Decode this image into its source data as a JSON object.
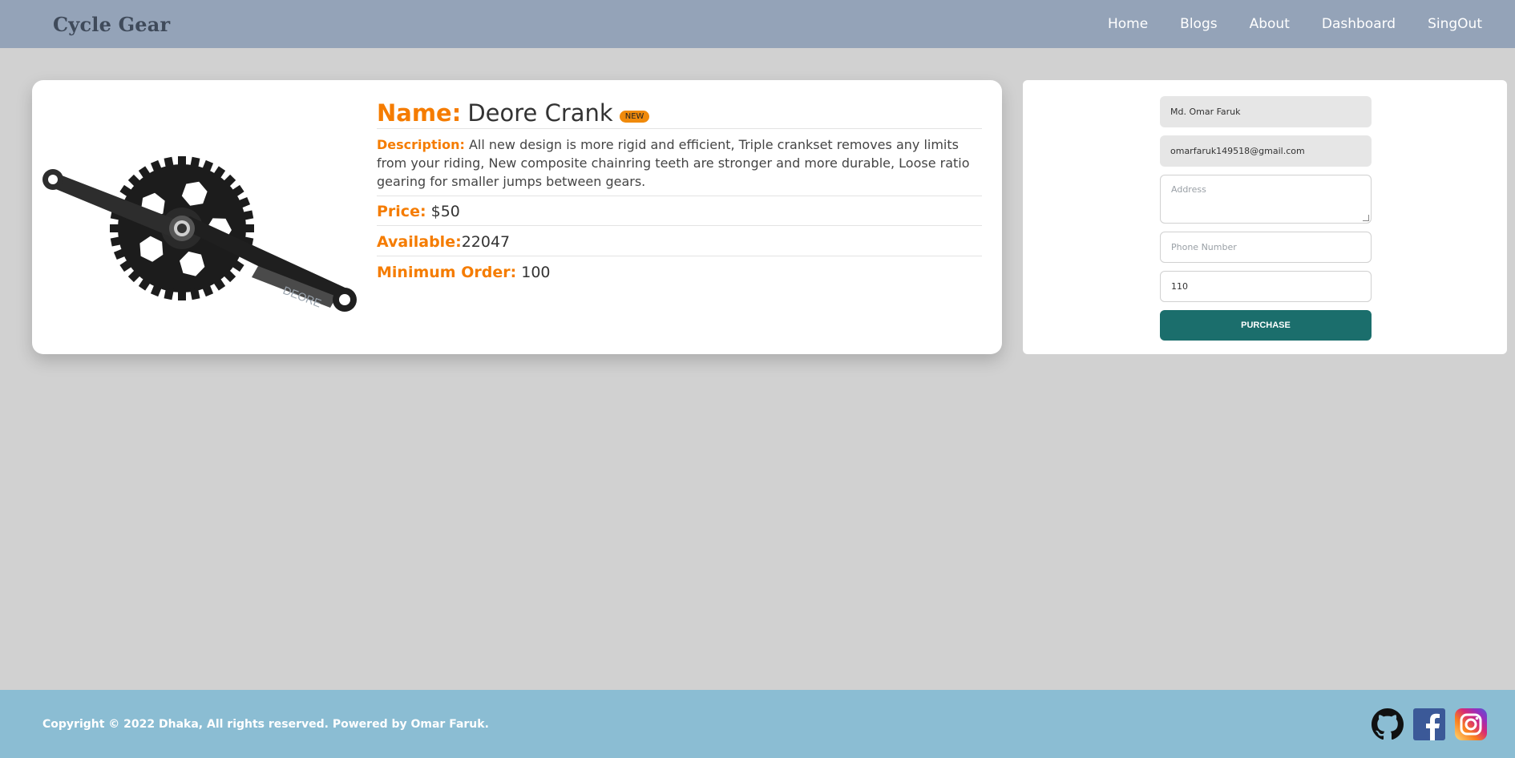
{
  "brand": "Cycle Gear",
  "nav": {
    "home": "Home",
    "blogs": "Blogs",
    "about": "About",
    "dashboard": "Dashboard",
    "signout": "SingOut"
  },
  "product": {
    "name_label": "Name:",
    "name": "Deore Crank",
    "badge": "NEW",
    "description_label": "Description:",
    "description": "All new design is more rigid and efficient, Triple crankset removes any limits from your riding, New composite chainring teeth are stronger and more durable, Loose ratio gearing for smaller jumps between gears.",
    "price_label": "Price:",
    "price": "$50",
    "available_label": "Available:",
    "available": "22047",
    "min_order_label": "Minimum Order:",
    "min_order": "100",
    "image_text": "DEORE"
  },
  "form": {
    "name_value": "Md. Omar Faruk",
    "email_value": "omarfaruk149518@gmail.com",
    "address_placeholder": "Address",
    "phone_placeholder": "Phone Number",
    "quantity_value": "110",
    "purchase_label": "PURCHASE"
  },
  "footer": {
    "copyright": "Copyright © 2022 Dhaka, All rights reserved. Powered by Omar Faruk."
  },
  "icons": {
    "github": "github-icon",
    "facebook": "facebook-icon",
    "instagram": "instagram-icon"
  },
  "colors": {
    "navbar": "#94a3b8",
    "accent": "#f57c00",
    "purchase": "#1b6e6c",
    "footer": "#8bbdd3"
  }
}
